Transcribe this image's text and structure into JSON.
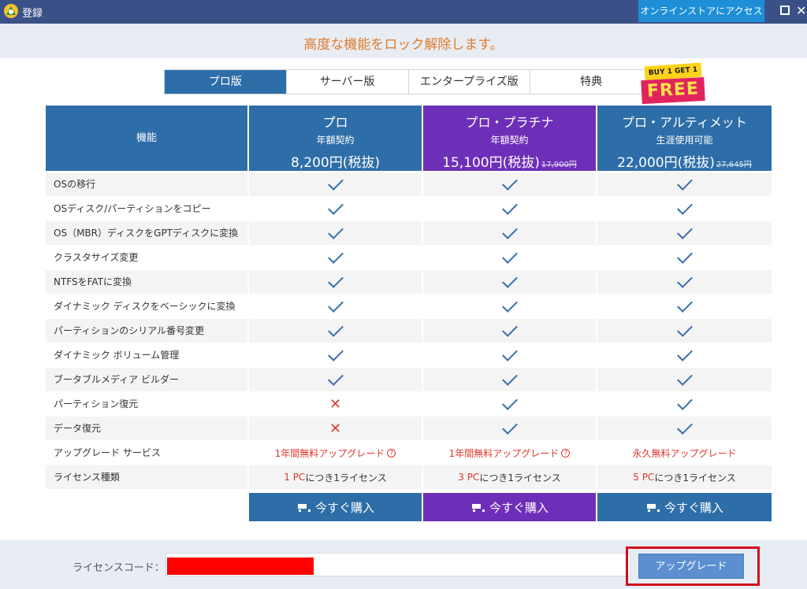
{
  "window": {
    "title": "登録",
    "store_button": "オンラインストアにアクセス"
  },
  "headline": "高度な機能をロック解除します。",
  "tabs": [
    {
      "label": "プロ版",
      "active": true
    },
    {
      "label": "サーバー版",
      "active": false
    },
    {
      "label": "エンタープライズ版",
      "active": false
    },
    {
      "label": "特典",
      "active": false
    }
  ],
  "promo": {
    "top": "BUY 1 GET 1",
    "main": "FREE"
  },
  "table": {
    "feature_header": "機能",
    "plans": [
      {
        "name": "プロ",
        "term": "年額契約",
        "price": "8,200円(税抜)",
        "old_price": ""
      },
      {
        "name": "プロ・プラチナ",
        "term": "年額契約",
        "price": "15,100円(税抜)",
        "old_price": "17,900円"
      },
      {
        "name": "プロ・アルティメット",
        "term": "生涯使用可能",
        "price": "22,000円(税抜)",
        "old_price": "27,645円"
      }
    ],
    "rows": [
      {
        "feature": "OSの移行",
        "values": [
          "check",
          "check",
          "check"
        ]
      },
      {
        "feature": "OSディスク/パーティションをコピー",
        "values": [
          "check",
          "check",
          "check"
        ]
      },
      {
        "feature": "OS（MBR）ディスクをGPTディスクに変換",
        "values": [
          "check",
          "check",
          "check"
        ]
      },
      {
        "feature": "クラスタサイズ変更",
        "values": [
          "check",
          "check",
          "check"
        ]
      },
      {
        "feature": "NTFSをFATに変換",
        "values": [
          "check",
          "check",
          "check"
        ]
      },
      {
        "feature": "ダイナミック ディスクをベーシックに変換",
        "values": [
          "check",
          "check",
          "check"
        ]
      },
      {
        "feature": "パーティションのシリアル番号変更",
        "values": [
          "check",
          "check",
          "check"
        ]
      },
      {
        "feature": "ダイナミック ボリューム管理",
        "values": [
          "check",
          "check",
          "check"
        ]
      },
      {
        "feature": "ブータブルメディア ビルダー",
        "values": [
          "check",
          "check",
          "check"
        ]
      },
      {
        "feature": "パーティション復元",
        "values": [
          "cross",
          "check",
          "check"
        ]
      },
      {
        "feature": "データ復元",
        "values": [
          "cross",
          "check",
          "check"
        ]
      }
    ],
    "upgrade_service": {
      "feature": "アップグレード サービス",
      "values": [
        "1年間無料アップグレード",
        "1年間無料アップグレード",
        "永久無料アップグレード"
      ],
      "help_mark": "?"
    },
    "license_type": {
      "feature": "ライセンス種類",
      "values": [
        {
          "count": "1 PC",
          "suffix": "につき1ライセンス"
        },
        {
          "count": "3 PC",
          "suffix": "につき1ライセンス"
        },
        {
          "count": "5 PC",
          "suffix": "につき1ライセンス"
        }
      ]
    },
    "buy_label": "今すぐ購入"
  },
  "footer": {
    "license_label": "ライセンスコード：",
    "license_value": "",
    "upgrade_button": "アップグレード"
  },
  "colors": {
    "titlebar": "#3a5187",
    "primary": "#2e6ea8",
    "platinum": "#6e2fb8",
    "headline": "#e07a2b",
    "accent_red": "#e0362c"
  }
}
